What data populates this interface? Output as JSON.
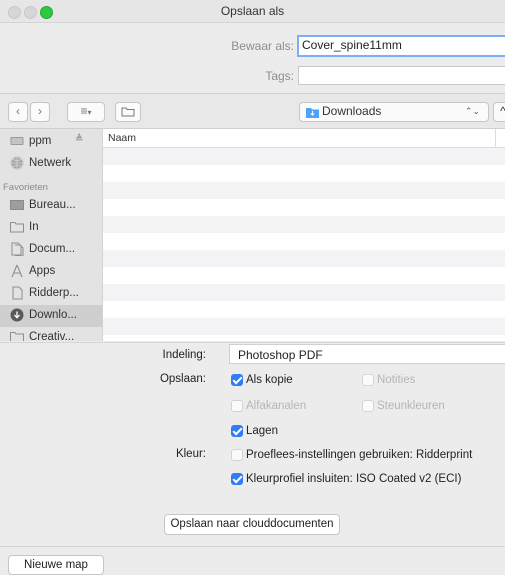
{
  "window": {
    "title": "Opslaan als"
  },
  "save_form": {
    "save_as_label": "Bewaar als:",
    "save_as_value": "Cover_spine11mm",
    "tags_label": "Tags:",
    "tags_value": ""
  },
  "toolbar": {
    "location": "Downloads"
  },
  "sidebar": {
    "devices": [
      {
        "label": "ppm",
        "icon": "disk-icon"
      },
      {
        "label": "Netwerk",
        "icon": "globe-icon"
      }
    ],
    "favorites_header": "Favorieten",
    "favorites": [
      {
        "label": "Bureau...",
        "icon": "desktop-icon"
      },
      {
        "label": "In",
        "icon": "folder-icon"
      },
      {
        "label": "Docum...",
        "icon": "document-icon"
      },
      {
        "label": "Apps",
        "icon": "apps-icon"
      },
      {
        "label": "Ridderp...",
        "icon": "file-icon"
      },
      {
        "label": "Downlo...",
        "icon": "download-icon"
      },
      {
        "label": "Creativ...",
        "icon": "folder-icon"
      }
    ]
  },
  "file_list": {
    "column_name": "Naam"
  },
  "options": {
    "format_label": "Indeling:",
    "format_value": "Photoshop PDF",
    "save_label": "Opslaan:",
    "as_copy": "Als kopie",
    "notes": "Notities",
    "alpha": "Alfakanalen",
    "spot": "Steunkleuren",
    "layers": "Lagen",
    "color_label": "Kleur:",
    "proof": "Proeflees-instellingen gebruiken: Ridderprint",
    "icc": "Kleurprofiel insluiten: ISO Coated v2 (ECI)",
    "cloud_button": "Opslaan naar clouddocumenten"
  },
  "footer": {
    "new_folder": "Nieuwe map"
  },
  "colors": {
    "accent": "#2f7cf6",
    "close": "#d8d8d8",
    "maximize": "#2fc840"
  }
}
